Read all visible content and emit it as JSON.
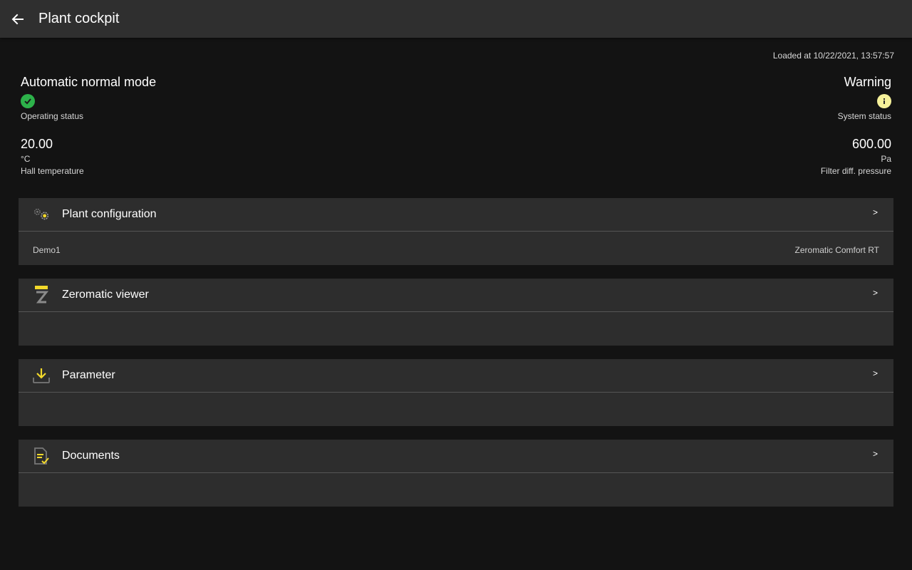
{
  "appbar": {
    "title": "Plant cockpit",
    "back_icon": "arrow-left-icon"
  },
  "loaded_text": "Loaded at 10/22/2021, 13:57:57",
  "operating": {
    "value": "Automatic normal mode",
    "label": "Operating status",
    "icon": "check-circle-icon",
    "color": "#2db24a"
  },
  "system": {
    "value": "Warning",
    "label": "System status",
    "icon": "info-circle-icon",
    "color": "#f6f19a"
  },
  "hall_temp": {
    "value": "20.00",
    "unit": "°C",
    "label": "Hall temperature"
  },
  "filter_pressure": {
    "value": "600.00",
    "unit": "Pa",
    "label": "Filter diff. pressure"
  },
  "cards": [
    {
      "title": "Plant configuration",
      "icon": "gears-icon",
      "arrow": ">",
      "left": "Demo1",
      "right": "Zeromatic Comfort RT"
    },
    {
      "title": "Zeromatic viewer",
      "icon": "zeromatic-logo-icon",
      "arrow": ">",
      "left": "",
      "right": ""
    },
    {
      "title": "Parameter",
      "icon": "download-icon",
      "arrow": ">",
      "left": "",
      "right": ""
    },
    {
      "title": "Documents",
      "icon": "document-check-icon",
      "arrow": ">",
      "left": "",
      "right": ""
    }
  ],
  "accent_color": "#f2d82a"
}
